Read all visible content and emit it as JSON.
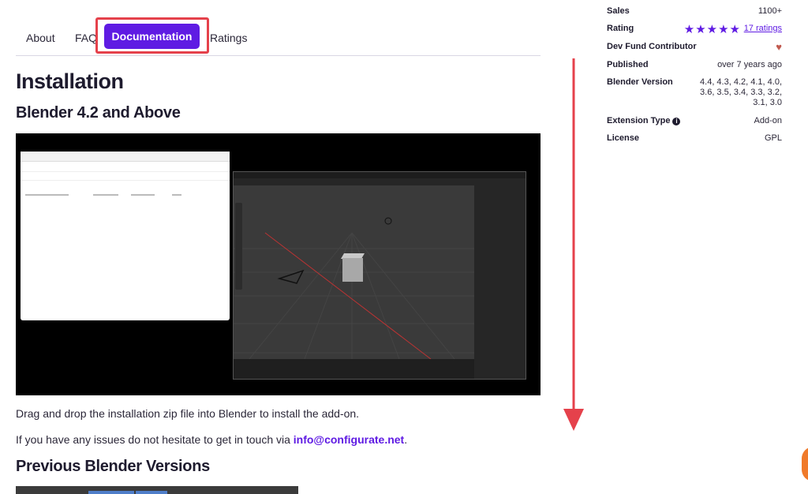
{
  "tabs": {
    "about": "About",
    "faq": "FAQ",
    "documentation": "Documentation",
    "ratings": "Ratings"
  },
  "main": {
    "title": "Installation",
    "section1": "Blender 4.2 and Above",
    "para1": "Drag and drop the installation zip file into Blender to install the add-on.",
    "para2_prefix": "If you have any issues do not hesitate to get in touch via ",
    "para2_link": "info@configurate.net",
    "para2_suffix": ".",
    "section2": "Previous Blender Versions"
  },
  "sidebar": {
    "sales_label": "Sales",
    "sales_value": "1100+",
    "rating_label": "Rating",
    "rating_stars": "★★★★★",
    "rating_count": "17 ratings",
    "devfund_label": "Dev Fund Contributor",
    "devfund_icon": "heart-icon",
    "published_label": "Published",
    "published_value": "over 7 years ago",
    "blender_label": "Blender Version",
    "blender_value": "4.4, 4.3, 4.2, 4.1, 4.0, 3.6, 3.5, 3.4, 3.3, 3.2, 3.1, 3.0",
    "ext_label": "Extension Type",
    "ext_value": "Add-on",
    "license_label": "License",
    "license_value": "GPL"
  },
  "colors": {
    "accent": "#5f1be3",
    "highlight": "#e5414b",
    "heart": "#c15a4f"
  }
}
